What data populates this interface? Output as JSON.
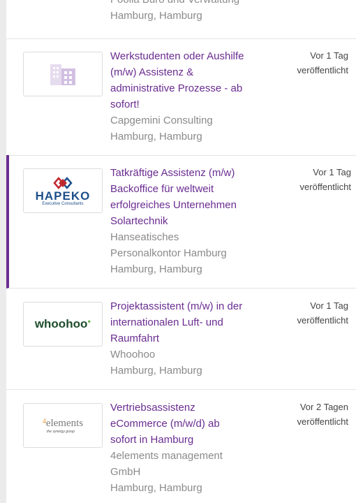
{
  "jobs": [
    {
      "title_lines": [
        "Poolia Büro und Verwaltung"
      ],
      "company_lines": [],
      "location": "Hamburg, Hamburg",
      "posted": [
        "",
        ""
      ]
    },
    {
      "title_lines": [
        "Werkstudenten oder Aushilfe",
        "(m/w) Assistenz &",
        "administrative Prozesse - ab",
        "sofort!"
      ],
      "company_lines": [
        "Capgemini Consulting"
      ],
      "location": "Hamburg, Hamburg",
      "posted": [
        "Vor 1 Tag",
        "veröffentlicht"
      ],
      "logo": "building-logo"
    },
    {
      "title_lines": [
        "Tatkräftige Assistenz (m/w)",
        "Backoffice für weltweit",
        "erfolgreiches Unternehmen",
        "Solartechnik"
      ],
      "company_lines": [
        "Hanseatisches",
        "Personalkontor Hamburg"
      ],
      "location": "Hamburg, Hamburg",
      "posted": [
        "Vor 1 Tag",
        "veröffentlicht"
      ],
      "logo": "hapeko-logo",
      "logo_text": "HAPEKO",
      "logo_subtext": "Executive Consultants"
    },
    {
      "title_lines": [
        "Projektassistent (m/w) in der",
        "internationalen Luft- und",
        "Raumfahrt"
      ],
      "company_lines": [
        "Whoohoo"
      ],
      "location": "Hamburg, Hamburg",
      "posted": [
        "Vor 1 Tag",
        "veröffentlicht"
      ],
      "logo": "whoohoo-logo",
      "logo_text": "whoohoo"
    },
    {
      "title_lines": [
        "Vertriebsassistenz",
        "eCommerce (m/w/d) ab",
        "sofort in Hamburg"
      ],
      "company_lines": [
        "4elements management",
        "GmbH"
      ],
      "location": "Hamburg, Hamburg",
      "posted": [
        "Vor 2 Tagen",
        "veröffentlicht"
      ],
      "logo": "4elements-logo",
      "logo_text": "elements",
      "logo_mark": "4",
      "logo_subtext": "the synergy group"
    }
  ],
  "colors": {
    "title": "#6a2c91",
    "meta": "#8a8a8a",
    "active_bar": "#6a2c91"
  }
}
